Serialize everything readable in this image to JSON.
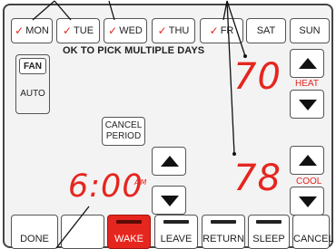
{
  "days": [
    {
      "label": "MON",
      "checked": true
    },
    {
      "label": "TUE",
      "checked": true
    },
    {
      "label": "WED",
      "checked": true
    },
    {
      "label": "THU",
      "checked": true
    },
    {
      "label": "FR",
      "checked": true
    },
    {
      "label": "SAT",
      "checked": false
    },
    {
      "label": "SUN",
      "checked": false
    }
  ],
  "check_mark": "✓",
  "banner": "OK TO PICK MULTIPLE DAYS",
  "fan": {
    "title": "FAN",
    "mode": "AUTO"
  },
  "heat": {
    "setpoint": "70",
    "label": "HEAT"
  },
  "cool": {
    "setpoint": "78",
    "label": "COOL"
  },
  "time": {
    "value": "6:00",
    "suffix": "AM"
  },
  "cancel_period": {
    "line1": "CANCEL",
    "line2": "PERIOD"
  },
  "buttons": {
    "done": "DONE",
    "wake": "WAKE",
    "leave": "LEAVE",
    "return": "RETURN",
    "sleep": "SLEEP",
    "cancel": "CANCEL"
  },
  "colors": {
    "accent": "#e5261f",
    "check": "#e0251f"
  }
}
